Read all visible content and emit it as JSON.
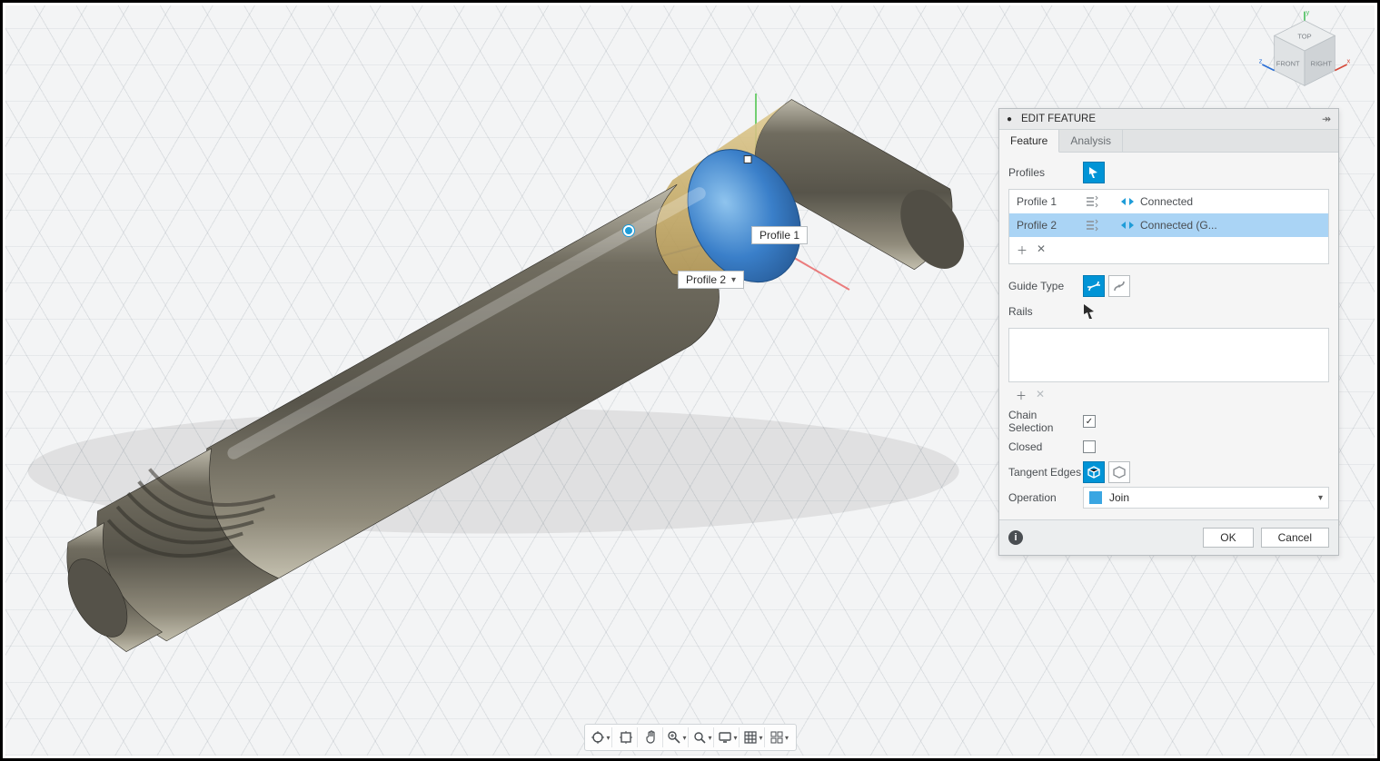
{
  "viewcube": {
    "top_label": "TOP",
    "front_label": "FRONT",
    "right_label": "RIGHT",
    "axis_x": "x",
    "axis_y": "y",
    "axis_z": "z"
  },
  "viewport_labels": {
    "profile1": "Profile 1",
    "profile2": "Profile 2"
  },
  "panel": {
    "title": "EDIT FEATURE",
    "tabs": {
      "feature": "Feature",
      "analysis": "Analysis"
    },
    "profiles_label": "Profiles",
    "profile_rows": [
      {
        "name": "Profile 1",
        "status": "Connected"
      },
      {
        "name": "Profile 2",
        "status": "Connected (G..."
      }
    ],
    "guide_type_label": "Guide Type",
    "rails_label": "Rails",
    "chain_selection_label": "Chain Selection",
    "chain_selection_checked": true,
    "closed_label": "Closed",
    "closed_checked": false,
    "tangent_edges_label": "Tangent Edges",
    "operation_label": "Operation",
    "operation_value": "Join",
    "ok": "OK",
    "cancel": "Cancel"
  },
  "nav_icons": {
    "orbit": "orbit-icon",
    "look": "look-at-icon",
    "pan": "pan-icon",
    "zoom": "zoom-icon",
    "fit": "fit-icon",
    "display": "display-settings-icon",
    "grid": "grid-display-icon",
    "viewports": "viewports-icon"
  }
}
